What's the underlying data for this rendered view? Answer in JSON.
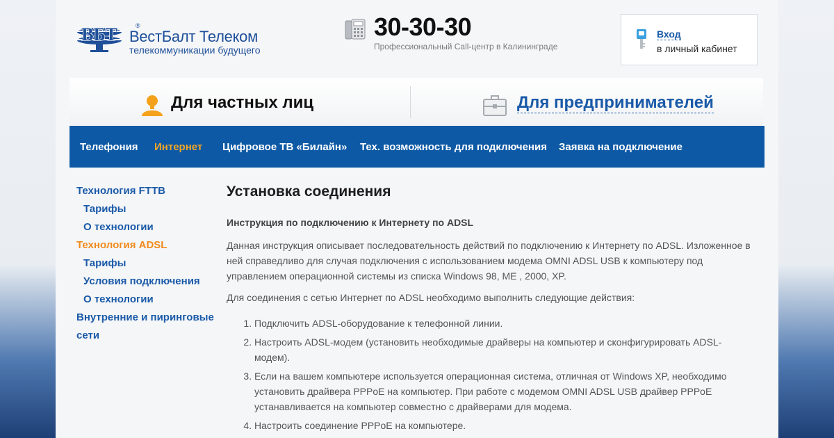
{
  "header": {
    "logo_name": "ВестБалт Телеком",
    "logo_tagline": "телекоммуникации будущего",
    "logo_reg": "®",
    "logo_mark": "ВБТ",
    "phone_number": "30-30-30",
    "phone_caption": "Профессиональный Call-центр в Калининграде",
    "login_link": "Вход",
    "login_sub": "в личный кабинет"
  },
  "segments": {
    "private": "Для частных лиц",
    "business": "Для предпринимателей"
  },
  "nav": {
    "items": [
      {
        "label": "Телефония",
        "active": false
      },
      {
        "label": "Интернет",
        "active": true
      },
      {
        "label": "Цифровое ТВ «Билайн»",
        "active": false
      },
      {
        "label": "Тех. возможность для подключения",
        "active": false
      },
      {
        "label": "Заявка на подключение",
        "active": false
      }
    ]
  },
  "sidebar": {
    "items": [
      {
        "label": "Технология FTTB"
      },
      {
        "label": "Тарифы"
      },
      {
        "label": "О технологии"
      },
      {
        "label": "Технология ADSL"
      },
      {
        "label": "Тарифы"
      },
      {
        "label": "Условия подключения"
      },
      {
        "label": "О технологии"
      },
      {
        "label": "Внутренние и пиринговые"
      },
      {
        "label": "сети"
      }
    ]
  },
  "content": {
    "title": "Установка соединения",
    "subtitle": "Инструкция по подключению к Интернету по ADSL",
    "para1": "Данная инструкция описывает последовательность действий по подключению к Интернету по ADSL. Изложенное в ней справедливо для случая подключения с использованием модема OMNI ADSL USB к компьютеру под управлением операционной системы из списка Windows  98, ME , 2000, XP.",
    "para2": "Для соединения с сетью Интернет по ADSL необходимо выполнить следующие действия:",
    "steps": [
      "Подключить ADSL-оборудование к телефонной линии.",
      "Настроить ADSL-модем (установить необходимые драйверы на компьютер и сконфигурировать ADSL-модем).",
      "Если на вашем компьютере используется операционная система, отличная от Windows XP, необходимо установить драйвера PPPoE на компьютер. При работе с модемом OMNI ADSL USB драйвер PPPoE устанавливается на компьютер совместно с драйверами для модема.",
      "Настроить соединение PPPoE на компьютере."
    ]
  },
  "colors": {
    "brand_blue": "#0d59a5",
    "link_blue": "#1a5aa8",
    "accent_orange": "#f5a623"
  },
  "icons": {
    "logo": "vbt-logo-icon",
    "phone": "phone-icon",
    "login": "key-icon",
    "private": "person-icon",
    "business": "briefcase-icon"
  }
}
